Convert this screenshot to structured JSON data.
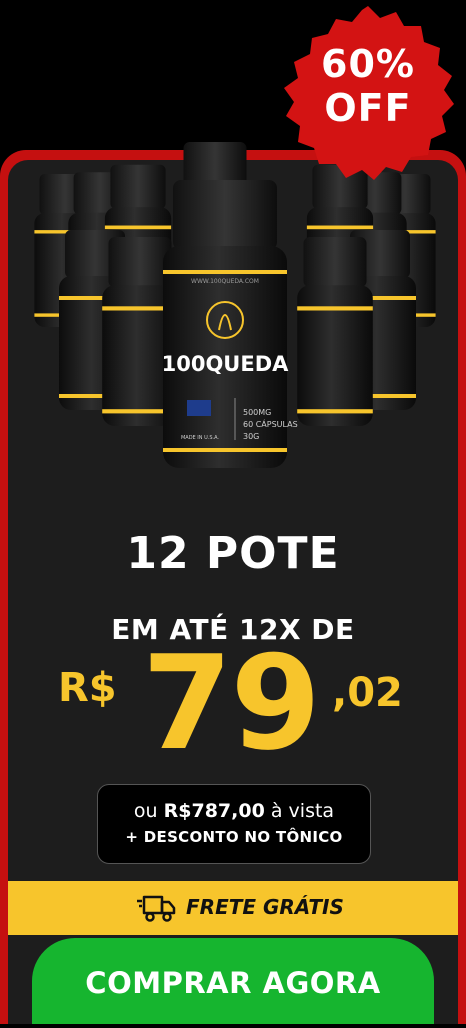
{
  "badge": {
    "line1": "60%",
    "line2": "OFF"
  },
  "product": {
    "brand": "100QUEDA",
    "website": "WWW.100QUEDA.COM",
    "specs": [
      "500MG",
      "60 CÁPSULAS",
      "30G"
    ],
    "origin_label": "MADE IN U.S.A."
  },
  "offer": {
    "title": "12 POTE",
    "subtitle": "EM ATÉ 12X DE",
    "currency": "R$",
    "price_int": "79",
    "price_cents": ",02"
  },
  "cash": {
    "prefix": "ou",
    "amount": "R$787,00",
    "suffix": "à vista",
    "bonus": "+ DESCONTO NO TÔNICO"
  },
  "shipping": {
    "label": "FRETE GRÁTIS"
  },
  "cta": {
    "label": "COMPRAR AGORA"
  },
  "colors": {
    "accent": "#f7c52c",
    "badge": "#d31313",
    "cta": "#16b52f",
    "panel": "#1d1d1d",
    "border": "#c51010"
  }
}
